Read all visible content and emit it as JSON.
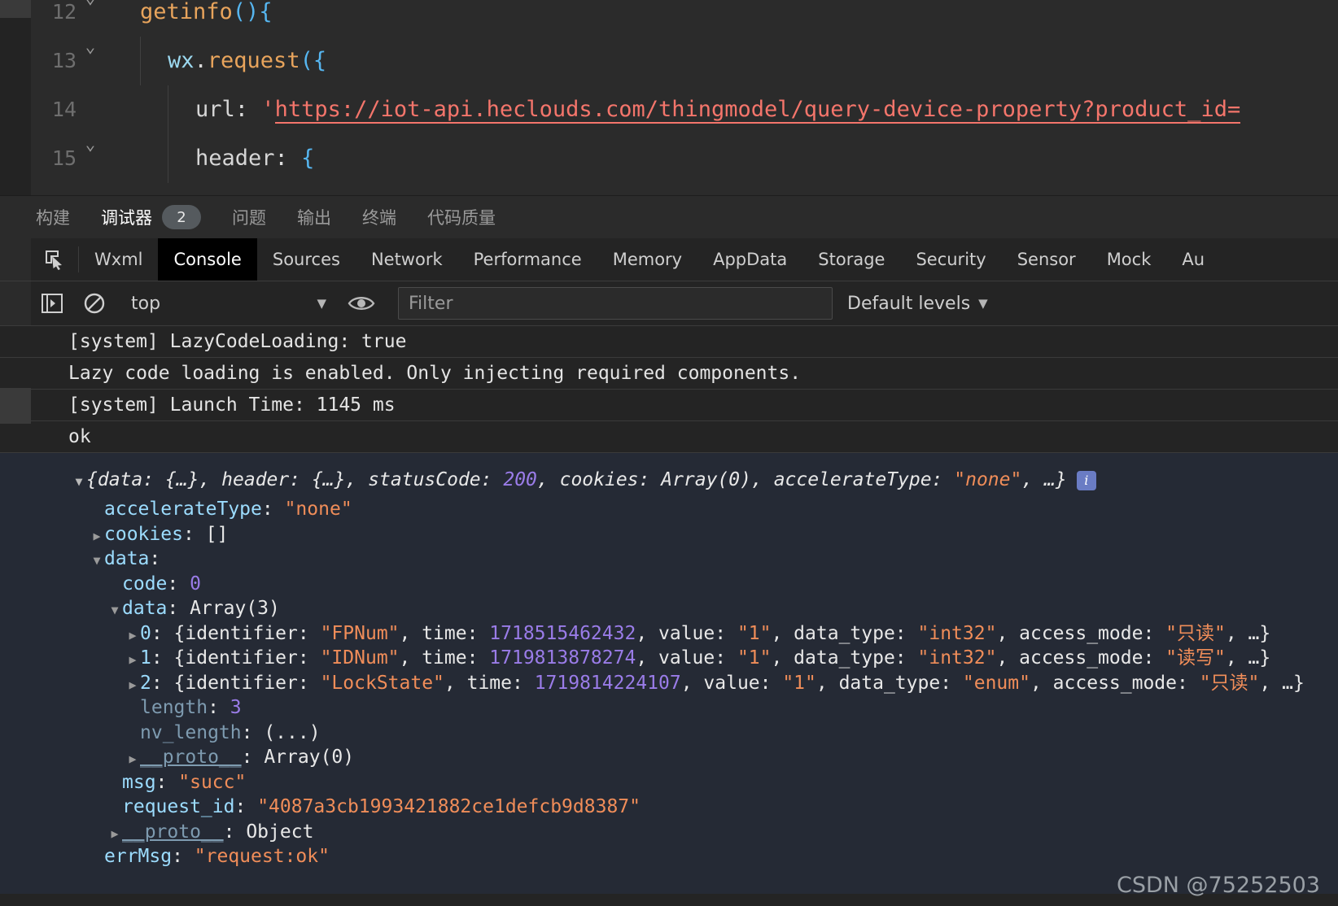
{
  "editor": {
    "lines": [
      {
        "num": "12",
        "fold": "chevron-down",
        "indent": 0,
        "tokens": [
          {
            "t": "getinfo",
            "c": "fn"
          },
          {
            "t": "()",
            "c": "brk"
          },
          {
            "t": "{",
            "c": "brk"
          }
        ]
      },
      {
        "num": "13",
        "fold": "chevron-down",
        "indent": 1,
        "tokens": [
          {
            "t": "wx",
            "c": "id"
          },
          {
            "t": ".",
            "c": "plain"
          },
          {
            "t": "request",
            "c": "fn"
          },
          {
            "t": "({",
            "c": "brk"
          }
        ]
      },
      {
        "num": "14",
        "fold": "",
        "indent": 2,
        "tokens": [
          {
            "t": "url",
            "c": "prop"
          },
          {
            "t": ": ",
            "c": "plain"
          },
          {
            "t": "'",
            "c": "str"
          },
          {
            "t": "https://iot-api.heclouds.com/thingmodel/query-device-property?product_id=",
            "c": "url"
          }
        ]
      },
      {
        "num": "15",
        "fold": "chevron-down",
        "indent": 2,
        "tokens": [
          {
            "t": "header",
            "c": "prop"
          },
          {
            "t": ": ",
            "c": "plain"
          },
          {
            "t": "{",
            "c": "brk"
          }
        ]
      }
    ]
  },
  "ide_tabs": {
    "items": [
      {
        "label": "构建",
        "active": false,
        "badge": ""
      },
      {
        "label": "调试器",
        "active": true,
        "badge": "2"
      },
      {
        "label": "问题",
        "active": false,
        "badge": ""
      },
      {
        "label": "输出",
        "active": false,
        "badge": ""
      },
      {
        "label": "终端",
        "active": false,
        "badge": ""
      },
      {
        "label": "代码质量",
        "active": false,
        "badge": ""
      }
    ]
  },
  "devtools_tabs": {
    "inspect_icon": "inspect-element-icon",
    "items": [
      {
        "label": "Wxml",
        "active": false
      },
      {
        "label": "Console",
        "active": true
      },
      {
        "label": "Sources",
        "active": false
      },
      {
        "label": "Network",
        "active": false
      },
      {
        "label": "Performance",
        "active": false
      },
      {
        "label": "Memory",
        "active": false
      },
      {
        "label": "AppData",
        "active": false
      },
      {
        "label": "Storage",
        "active": false
      },
      {
        "label": "Security",
        "active": false
      },
      {
        "label": "Sensor",
        "active": false
      },
      {
        "label": "Mock",
        "active": false
      },
      {
        "label": "Au",
        "active": false
      }
    ]
  },
  "console_toolbar": {
    "sidebar_icon": "console-sidebar-icon",
    "clear_icon": "clear-console-icon",
    "context_value": "top",
    "context_caret": "▼",
    "eye_icon": "live-expression-eye-icon",
    "filter_placeholder": "Filter",
    "levels_label": "Default levels",
    "levels_caret": "▼"
  },
  "console_messages": [
    {
      "text": "[system] LazyCodeLoading: true"
    },
    {
      "text": "Lazy code loading is enabled. Only injecting required components."
    },
    {
      "text": "[system] Launch Time: 1145 ms"
    },
    {
      "text": "ok"
    }
  ],
  "object_tree": {
    "header": {
      "arrow": "▼",
      "parts": [
        {
          "t": "{data: {…}, header: {…}, statusCode: ",
          "c": "w"
        },
        {
          "t": "200",
          "c": "n"
        },
        {
          "t": ", cookies: Array(0), accelerateType: ",
          "c": "w"
        },
        {
          "t": "\"none\"",
          "c": "s"
        },
        {
          "t": ", …}",
          "c": "w"
        }
      ],
      "info_badge": "i"
    },
    "rows": [
      {
        "indent": 1,
        "arrow": "",
        "parts": [
          {
            "t": "accelerateType",
            "c": "k"
          },
          {
            "t": ": ",
            "c": "w"
          },
          {
            "t": "\"none\"",
            "c": "s"
          }
        ]
      },
      {
        "indent": 1,
        "arrow": "▶",
        "parts": [
          {
            "t": "cookies",
            "c": "k"
          },
          {
            "t": ": ",
            "c": "w"
          },
          {
            "t": "[]",
            "c": "w"
          }
        ]
      },
      {
        "indent": 1,
        "arrow": "▼",
        "parts": [
          {
            "t": "data",
            "c": "k"
          },
          {
            "t": ":",
            "c": "w"
          }
        ]
      },
      {
        "indent": 2,
        "arrow": "",
        "parts": [
          {
            "t": "code",
            "c": "k"
          },
          {
            "t": ": ",
            "c": "w"
          },
          {
            "t": "0",
            "c": "n"
          }
        ]
      },
      {
        "indent": 2,
        "arrow": "▼",
        "parts": [
          {
            "t": "data",
            "c": "k"
          },
          {
            "t": ": ",
            "c": "w"
          },
          {
            "t": "Array(3)",
            "c": "w"
          }
        ]
      },
      {
        "indent": 3,
        "arrow": "▶",
        "parts": [
          {
            "t": "0",
            "c": "idx"
          },
          {
            "t": ": {identifier: ",
            "c": "w"
          },
          {
            "t": "\"FPNum\"",
            "c": "s"
          },
          {
            "t": ", time: ",
            "c": "w"
          },
          {
            "t": "1718515462432",
            "c": "n"
          },
          {
            "t": ", value: ",
            "c": "w"
          },
          {
            "t": "\"1\"",
            "c": "s"
          },
          {
            "t": ", data_type: ",
            "c": "w"
          },
          {
            "t": "\"int32\"",
            "c": "s"
          },
          {
            "t": ", access_mode: ",
            "c": "w"
          },
          {
            "t": "\"只读\"",
            "c": "s"
          },
          {
            "t": ", …}",
            "c": "w"
          }
        ]
      },
      {
        "indent": 3,
        "arrow": "▶",
        "parts": [
          {
            "t": "1",
            "c": "idx"
          },
          {
            "t": ": {identifier: ",
            "c": "w"
          },
          {
            "t": "\"IDNum\"",
            "c": "s"
          },
          {
            "t": ", time: ",
            "c": "w"
          },
          {
            "t": "1719813878274",
            "c": "n"
          },
          {
            "t": ", value: ",
            "c": "w"
          },
          {
            "t": "\"1\"",
            "c": "s"
          },
          {
            "t": ", data_type: ",
            "c": "w"
          },
          {
            "t": "\"int32\"",
            "c": "s"
          },
          {
            "t": ", access_mode: ",
            "c": "w"
          },
          {
            "t": "\"读写\"",
            "c": "s"
          },
          {
            "t": ", …}",
            "c": "w"
          }
        ]
      },
      {
        "indent": 3,
        "arrow": "▶",
        "parts": [
          {
            "t": "2",
            "c": "idx"
          },
          {
            "t": ": {identifier: ",
            "c": "w"
          },
          {
            "t": "\"LockState\"",
            "c": "s"
          },
          {
            "t": ", time: ",
            "c": "w"
          },
          {
            "t": "1719814224107",
            "c": "n"
          },
          {
            "t": ", value: ",
            "c": "w"
          },
          {
            "t": "\"1\"",
            "c": "s"
          },
          {
            "t": ", data_type: ",
            "c": "w"
          },
          {
            "t": "\"enum\"",
            "c": "s"
          },
          {
            "t": ", access_mode: ",
            "c": "w"
          },
          {
            "t": "\"只读\"",
            "c": "s"
          },
          {
            "t": ", …}",
            "c": "w"
          }
        ]
      },
      {
        "indent": 3,
        "arrow": "",
        "parts": [
          {
            "t": "length",
            "c": "k-dim"
          },
          {
            "t": ": ",
            "c": "w"
          },
          {
            "t": "3",
            "c": "n"
          }
        ]
      },
      {
        "indent": 3,
        "arrow": "",
        "parts": [
          {
            "t": "nv_length",
            "c": "k-dim"
          },
          {
            "t": ": ",
            "c": "w"
          },
          {
            "t": "(...)",
            "c": "w"
          }
        ]
      },
      {
        "indent": 3,
        "arrow": "▶",
        "parts": [
          {
            "t": "__proto__",
            "c": "k-proto"
          },
          {
            "t": ": ",
            "c": "w"
          },
          {
            "t": "Array(0)",
            "c": "w"
          }
        ]
      },
      {
        "indent": 2,
        "arrow": "",
        "parts": [
          {
            "t": "msg",
            "c": "k"
          },
          {
            "t": ": ",
            "c": "w"
          },
          {
            "t": "\"succ\"",
            "c": "s"
          }
        ]
      },
      {
        "indent": 2,
        "arrow": "",
        "parts": [
          {
            "t": "request_id",
            "c": "k"
          },
          {
            "t": ": ",
            "c": "w"
          },
          {
            "t": "\"4087a3cb1993421882ce1defcb9d8387\"",
            "c": "s"
          }
        ]
      },
      {
        "indent": 2,
        "arrow": "▶",
        "parts": [
          {
            "t": "__proto__",
            "c": "k-proto"
          },
          {
            "t": ": ",
            "c": "w"
          },
          {
            "t": "Object",
            "c": "w"
          }
        ]
      },
      {
        "indent": 1,
        "arrow": "",
        "parts": [
          {
            "t": "errMsg",
            "c": "k"
          },
          {
            "t": ": ",
            "c": "w"
          },
          {
            "t": "\"request:ok\"",
            "c": "s"
          }
        ]
      }
    ]
  },
  "watermark": {
    "text": "CSDN @75252503"
  }
}
